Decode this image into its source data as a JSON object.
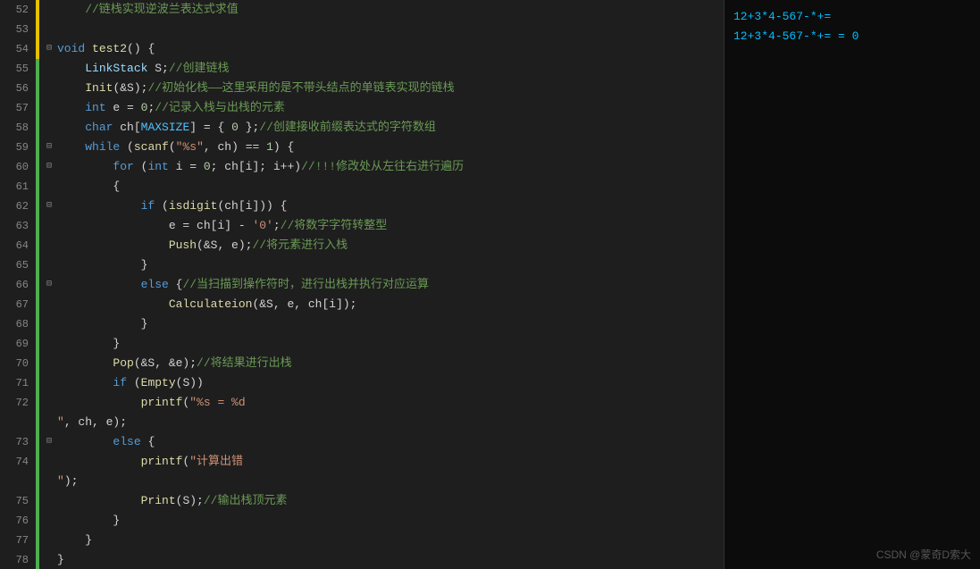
{
  "editor": {
    "lines": [
      {
        "num": 52,
        "gutter": "yellow",
        "fold": false,
        "content": "    <span class='cmt'>//链栈实现逆波兰表达式求值</span>"
      },
      {
        "num": 53,
        "gutter": "yellow",
        "fold": false,
        "content": ""
      },
      {
        "num": 54,
        "gutter": "yellow",
        "fold": true,
        "content": "<span class='kw'>void</span> <span class='fn'>test2</span>() {"
      },
      {
        "num": 55,
        "gutter": "green",
        "fold": false,
        "content": "    <span class='var'>LinkStack</span> S;<span class='cmt'>//创建链栈</span>"
      },
      {
        "num": 56,
        "gutter": "green",
        "fold": false,
        "content": "    <span class='fn'>Init</span>(&amp;S);<span class='cmt'>//初始化栈——这里采用的是不带头结点的单链表实现的链栈</span>"
      },
      {
        "num": 57,
        "gutter": "green",
        "fold": false,
        "content": "    <span class='kw'>int</span> e = <span class='num'>0</span>;<span class='cmt'>//记录入栈与出栈的元素</span>"
      },
      {
        "num": 58,
        "gutter": "green",
        "fold": false,
        "content": "    <span class='kw'>char</span> ch[<span class='cn'>MAXSIZE</span>] = { <span class='num'>0</span> };<span class='cmt'>//创建接收前缀表达式的字符数组</span>"
      },
      {
        "num": 59,
        "gutter": "green",
        "fold": true,
        "content": "    <span class='kw'>while</span> (<span class='fn'>scanf</span>(<span class='str'>\"%s\"</span>, ch) == <span class='num'>1</span>) {"
      },
      {
        "num": 60,
        "gutter": "green",
        "fold": true,
        "content": "        <span class='kw'>for</span> (<span class='kw'>int</span> i = <span class='num'>0</span>; ch[i]; i++)<span class='cmt'>//!!!修改处从左往右进行遍历</span>"
      },
      {
        "num": 61,
        "gutter": "green",
        "fold": false,
        "content": "        {"
      },
      {
        "num": 62,
        "gutter": "green",
        "fold": true,
        "content": "            <span class='kw'>if</span> (<span class='fn'>isdigit</span>(ch[i])) {"
      },
      {
        "num": 63,
        "gutter": "green",
        "fold": false,
        "content": "                e = ch[i] - <span class='str'>'0'</span>;<span class='cmt'>//将数字字符转整型</span>"
      },
      {
        "num": 64,
        "gutter": "green",
        "fold": false,
        "content": "                <span class='fn'>Push</span>(&amp;S, e);<span class='cmt'>//将元素进行入栈</span>"
      },
      {
        "num": 65,
        "gutter": "green",
        "fold": false,
        "content": "            }"
      },
      {
        "num": 66,
        "gutter": "green",
        "fold": true,
        "content": "            <span class='kw'>else</span> {<span class='cmt'>//当扫描到操作符时，进行出栈并执行对应运算</span>"
      },
      {
        "num": 67,
        "gutter": "green",
        "fold": false,
        "content": "                <span class='fn'>Calculateion</span>(&amp;S, e, ch[i]);"
      },
      {
        "num": 68,
        "gutter": "green",
        "fold": false,
        "content": "            }"
      },
      {
        "num": 69,
        "gutter": "green",
        "fold": false,
        "content": "        }"
      },
      {
        "num": 70,
        "gutter": "green",
        "fold": false,
        "content": "        <span class='fn'>Pop</span>(&amp;S, &amp;e);<span class='cmt'>//将结果进行出栈</span>"
      },
      {
        "num": 71,
        "gutter": "green",
        "fold": false,
        "content": "        <span class='kw'>if</span> (<span class='fn'>Empty</span>(S))"
      },
      {
        "num": 72,
        "gutter": "green",
        "fold": false,
        "content": "            <span class='fn'>printf</span>(<span class='str'>\"%s = %d\\n\"</span>, ch, e);"
      },
      {
        "num": 73,
        "gutter": "green",
        "fold": true,
        "content": "        <span class='kw'>else</span> {"
      },
      {
        "num": 74,
        "gutter": "green",
        "fold": false,
        "content": "            <span class='fn'>printf</span>(<span class='str'>\"计算出错\\n\"</span>);"
      },
      {
        "num": 75,
        "gutter": "green",
        "fold": false,
        "content": "            <span class='fn'>Print</span>(S);<span class='cmt'>//输出栈顶元素</span>"
      },
      {
        "num": 76,
        "gutter": "green",
        "fold": false,
        "content": "        }"
      },
      {
        "num": 77,
        "gutter": "green",
        "fold": false,
        "content": "    }"
      },
      {
        "num": 78,
        "gutter": "green",
        "fold": false,
        "content": "}"
      }
    ]
  },
  "output": {
    "lines": [
      "12+3*4-567-*+=",
      "12+3*4-567-*+= = 0"
    ]
  },
  "watermark": "CSDN @蒙奇D索大"
}
